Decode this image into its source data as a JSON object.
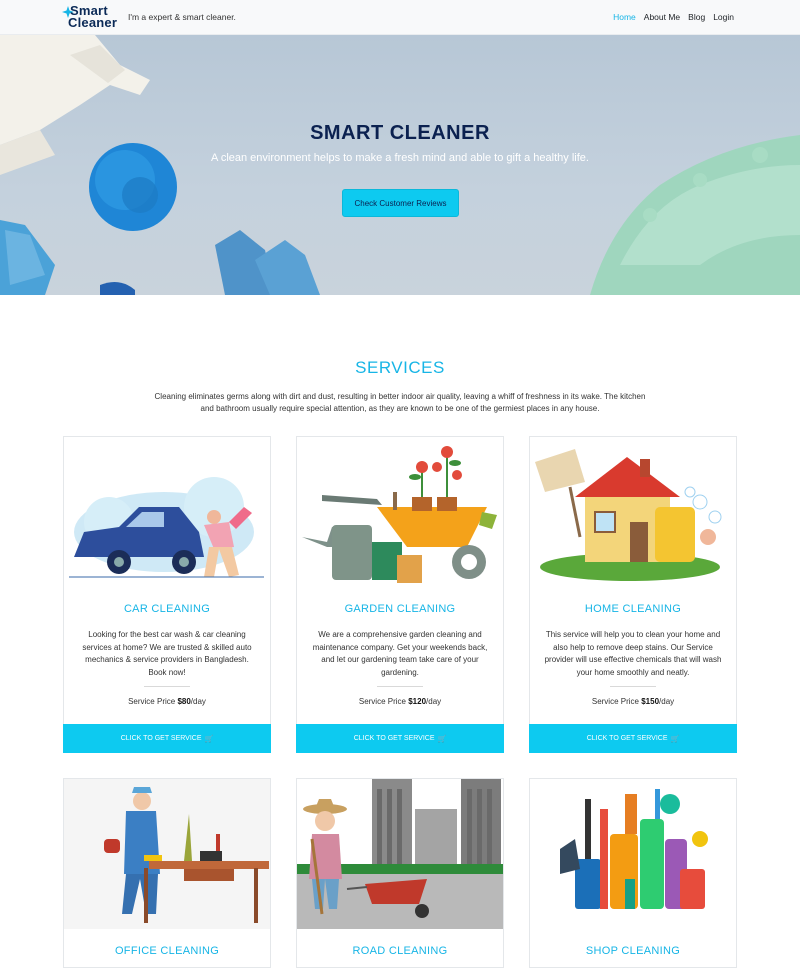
{
  "nav": {
    "logo_line1": "Smart",
    "logo_line2": "Cleaner",
    "tagline": "I'm a expert & smart cleaner.",
    "items": [
      {
        "label": "Home",
        "active": true
      },
      {
        "label": "About Me",
        "active": false
      },
      {
        "label": "Blog",
        "active": false
      },
      {
        "label": "Login",
        "active": false
      }
    ]
  },
  "hero": {
    "title": "SMART CLEANER",
    "subtitle": "A clean environment helps to make a fresh mind and able to gift a healthy life.",
    "button_label": "Check Customer Reviews"
  },
  "services": {
    "title": "SERVICES",
    "description": "Cleaning eliminates germs along with dirt and dust, resulting in better indoor air quality, leaving a whiff of freshness in its wake. The kitchen and bathroom usually require special attention, as they are known to be one of the germiest places in any house.",
    "button_label": "CLICK TO GET SERVICE",
    "price_prefix": "Service Price",
    "price_suffix": "/day",
    "cards": [
      {
        "title": "CAR CLEANING",
        "description": "Looking for the best car wash & car cleaning services at home? We are trusted & skilled auto mechanics & service providers in Bangladesh. Book now!",
        "price": "$80",
        "illustration": "car-wash-illustration"
      },
      {
        "title": "GARDEN CLEANING",
        "description": "We are a comprehensive garden cleaning and maintenance company. Get your weekends back, and let our gardening team take care of your gardening.",
        "price": "$120",
        "illustration": "garden-tools-illustration"
      },
      {
        "title": "HOME CLEANING",
        "description": "This service will help you to clean your home and also help to remove deep stains. Our Service provider will use effective chemicals that will wash your home smoothly and neatly.",
        "price": "$150",
        "illustration": "house-cleaning-illustration"
      },
      {
        "title": "OFFICE CLEANING",
        "illustration": "office-cleaner-illustration"
      },
      {
        "title": "ROAD CLEANING",
        "illustration": "road-sweeper-illustration"
      },
      {
        "title": "SHOP CLEANING",
        "illustration": "cleaning-supplies-illustration"
      }
    ]
  },
  "colors": {
    "accent": "#0dcaf0",
    "heading": "#17b5e6",
    "navy": "#0b2150"
  }
}
